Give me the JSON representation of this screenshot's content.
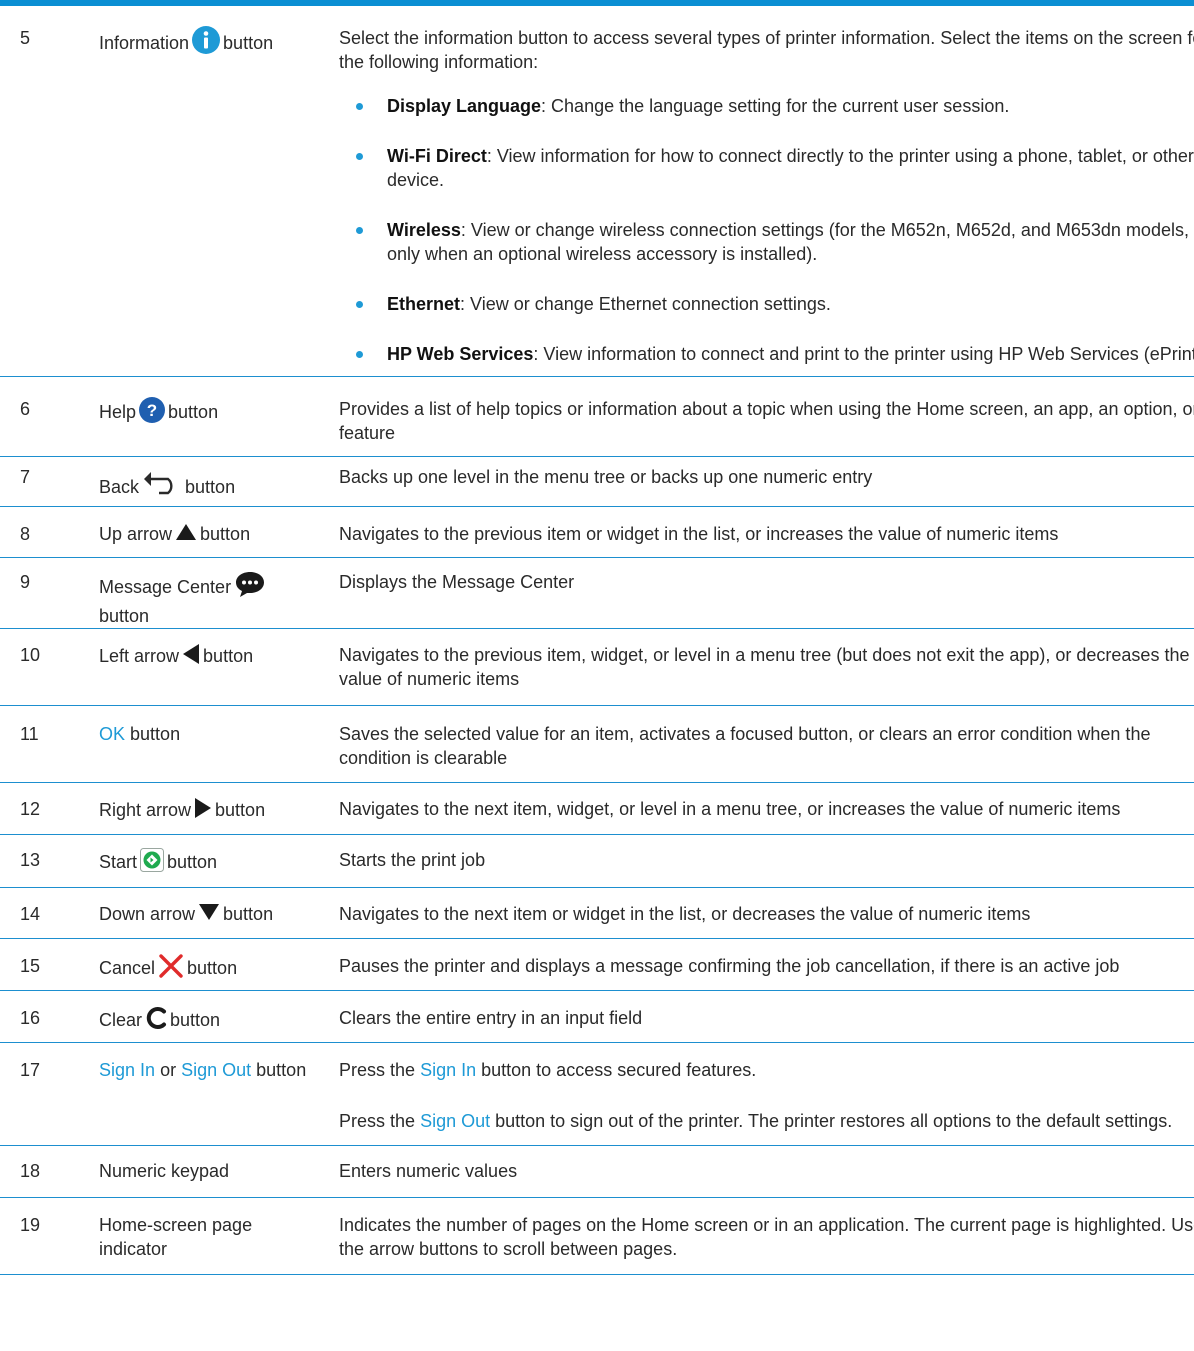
{
  "colors": {
    "accent": "#0b8fd3",
    "link": "#1e9ad6",
    "start_green": "#1faa4f",
    "cancel_red": "#e02b2b"
  },
  "rows": [
    {
      "num": "5",
      "label": "Information",
      "icon": "information-icon",
      "suffix": "button",
      "desc": "Select the information button to access several types of printer information. Select the items on the screen for the following information:",
      "bullets": [
        {
          "term": "Display Language",
          "text": ": Change the language setting for the current user session."
        },
        {
          "term": "Wi-Fi Direct",
          "text": ": View information for how to connect directly to the printer using a phone, tablet, or other device."
        },
        {
          "term": "Wireless",
          "text": ": View or change wireless connection settings (for the M652n, M652d, and M653dn models, only when an optional wireless accessory is installed)."
        },
        {
          "term": "Ethernet",
          "text": ": View or change Ethernet connection settings."
        },
        {
          "term": "HP Web Services",
          "text": ": View information to connect and print to the printer using HP Web Services (ePrint)."
        }
      ]
    },
    {
      "num": "6",
      "label": "Help",
      "icon": "help-icon",
      "suffix": "button",
      "desc": "Provides a list of help topics or information about a topic when using the Home screen, an app, an option, or a feature"
    },
    {
      "num": "7",
      "label": "Back",
      "icon": "back-arrow-icon",
      "suffix": "button",
      "desc": "Backs up one level in the menu tree or backs up one numeric entry"
    },
    {
      "num": "8",
      "label": "Up arrow",
      "icon": "up-arrow-icon",
      "suffix": "button",
      "desc": "Navigates to the previous item or widget in the list, or increases the value of numeric items"
    },
    {
      "num": "9",
      "label": "Message Center",
      "icon": "message-center-icon",
      "suffix": "button",
      "desc": "Displays the Message Center"
    },
    {
      "num": "10",
      "label": "Left arrow",
      "icon": "left-arrow-icon",
      "suffix": "button",
      "desc": "Navigates to the previous item, widget, or level in a menu tree (but does not exit the app), or decreases the value of numeric items"
    },
    {
      "num": "11",
      "label": "OK",
      "suffix": "button",
      "desc": "Saves the selected value for an item, activates a focused button, or clears an error condition when the condition is clearable"
    },
    {
      "num": "12",
      "label": "Right arrow",
      "icon": "right-arrow-icon",
      "suffix": "button",
      "desc": "Navigates to the next item, widget, or level in a menu tree, or increases the value of numeric items"
    },
    {
      "num": "13",
      "label": "Start",
      "icon": "start-icon",
      "suffix": "button",
      "desc": "Starts the print job"
    },
    {
      "num": "14",
      "label": "Down arrow",
      "icon": "down-arrow-icon",
      "suffix": "button",
      "desc": "Navigates to the next item or widget in the list, or decreases the value of numeric items"
    },
    {
      "num": "15",
      "label": "Cancel",
      "icon": "cancel-icon",
      "suffix": "button",
      "desc": "Pauses the printer and displays a message confirming the job cancellation, if there is an active job"
    },
    {
      "num": "16",
      "label": "Clear",
      "icon": "clear-icon",
      "suffix": "button",
      "desc": "Clears the entire entry in an input field"
    },
    {
      "num": "17",
      "label_a": "Sign In",
      "label_or": "or",
      "label_b": "Sign Out",
      "suffix": "button",
      "p1_pre": "Press the",
      "p1_link": "Sign In",
      "p1_post": "button to access secured features.",
      "p2_pre": "Press the",
      "p2_link": "Sign Out",
      "p2_post": "button to sign out of the printer. The printer restores all options to the default settings."
    },
    {
      "num": "18",
      "label": "Numeric keypad",
      "desc": "Enters numeric values"
    },
    {
      "num": "19",
      "label": "Home-screen page indicator",
      "desc": "Indicates the number of pages on the Home screen or in an application. The current page is highlighted. Use the arrow buttons to scroll between pages."
    }
  ]
}
